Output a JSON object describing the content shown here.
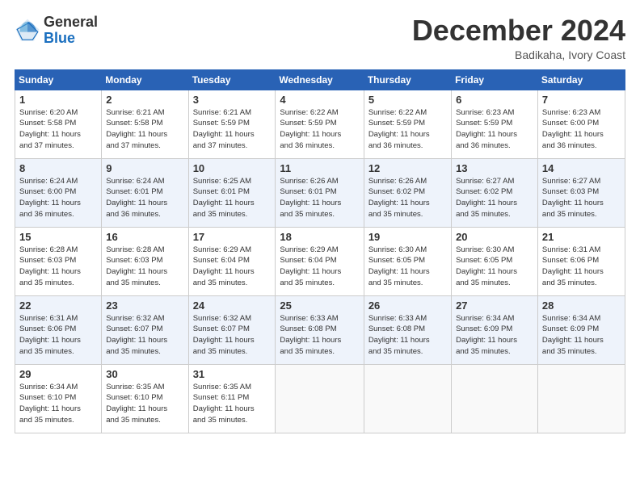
{
  "header": {
    "logo_line1": "General",
    "logo_line2": "Blue",
    "month": "December 2024",
    "location": "Badikaha, Ivory Coast"
  },
  "weekdays": [
    "Sunday",
    "Monday",
    "Tuesday",
    "Wednesday",
    "Thursday",
    "Friday",
    "Saturday"
  ],
  "weeks": [
    [
      {
        "day": "1",
        "info": "Sunrise: 6:20 AM\nSunset: 5:58 PM\nDaylight: 11 hours\nand 37 minutes."
      },
      {
        "day": "2",
        "info": "Sunrise: 6:21 AM\nSunset: 5:58 PM\nDaylight: 11 hours\nand 37 minutes."
      },
      {
        "day": "3",
        "info": "Sunrise: 6:21 AM\nSunset: 5:59 PM\nDaylight: 11 hours\nand 37 minutes."
      },
      {
        "day": "4",
        "info": "Sunrise: 6:22 AM\nSunset: 5:59 PM\nDaylight: 11 hours\nand 36 minutes."
      },
      {
        "day": "5",
        "info": "Sunrise: 6:22 AM\nSunset: 5:59 PM\nDaylight: 11 hours\nand 36 minutes."
      },
      {
        "day": "6",
        "info": "Sunrise: 6:23 AM\nSunset: 5:59 PM\nDaylight: 11 hours\nand 36 minutes."
      },
      {
        "day": "7",
        "info": "Sunrise: 6:23 AM\nSunset: 6:00 PM\nDaylight: 11 hours\nand 36 minutes."
      }
    ],
    [
      {
        "day": "8",
        "info": "Sunrise: 6:24 AM\nSunset: 6:00 PM\nDaylight: 11 hours\nand 36 minutes."
      },
      {
        "day": "9",
        "info": "Sunrise: 6:24 AM\nSunset: 6:01 PM\nDaylight: 11 hours\nand 36 minutes."
      },
      {
        "day": "10",
        "info": "Sunrise: 6:25 AM\nSunset: 6:01 PM\nDaylight: 11 hours\nand 35 minutes."
      },
      {
        "day": "11",
        "info": "Sunrise: 6:26 AM\nSunset: 6:01 PM\nDaylight: 11 hours\nand 35 minutes."
      },
      {
        "day": "12",
        "info": "Sunrise: 6:26 AM\nSunset: 6:02 PM\nDaylight: 11 hours\nand 35 minutes."
      },
      {
        "day": "13",
        "info": "Sunrise: 6:27 AM\nSunset: 6:02 PM\nDaylight: 11 hours\nand 35 minutes."
      },
      {
        "day": "14",
        "info": "Sunrise: 6:27 AM\nSunset: 6:03 PM\nDaylight: 11 hours\nand 35 minutes."
      }
    ],
    [
      {
        "day": "15",
        "info": "Sunrise: 6:28 AM\nSunset: 6:03 PM\nDaylight: 11 hours\nand 35 minutes."
      },
      {
        "day": "16",
        "info": "Sunrise: 6:28 AM\nSunset: 6:03 PM\nDaylight: 11 hours\nand 35 minutes."
      },
      {
        "day": "17",
        "info": "Sunrise: 6:29 AM\nSunset: 6:04 PM\nDaylight: 11 hours\nand 35 minutes."
      },
      {
        "day": "18",
        "info": "Sunrise: 6:29 AM\nSunset: 6:04 PM\nDaylight: 11 hours\nand 35 minutes."
      },
      {
        "day": "19",
        "info": "Sunrise: 6:30 AM\nSunset: 6:05 PM\nDaylight: 11 hours\nand 35 minutes."
      },
      {
        "day": "20",
        "info": "Sunrise: 6:30 AM\nSunset: 6:05 PM\nDaylight: 11 hours\nand 35 minutes."
      },
      {
        "day": "21",
        "info": "Sunrise: 6:31 AM\nSunset: 6:06 PM\nDaylight: 11 hours\nand 35 minutes."
      }
    ],
    [
      {
        "day": "22",
        "info": "Sunrise: 6:31 AM\nSunset: 6:06 PM\nDaylight: 11 hours\nand 35 minutes."
      },
      {
        "day": "23",
        "info": "Sunrise: 6:32 AM\nSunset: 6:07 PM\nDaylight: 11 hours\nand 35 minutes."
      },
      {
        "day": "24",
        "info": "Sunrise: 6:32 AM\nSunset: 6:07 PM\nDaylight: 11 hours\nand 35 minutes."
      },
      {
        "day": "25",
        "info": "Sunrise: 6:33 AM\nSunset: 6:08 PM\nDaylight: 11 hours\nand 35 minutes."
      },
      {
        "day": "26",
        "info": "Sunrise: 6:33 AM\nSunset: 6:08 PM\nDaylight: 11 hours\nand 35 minutes."
      },
      {
        "day": "27",
        "info": "Sunrise: 6:34 AM\nSunset: 6:09 PM\nDaylight: 11 hours\nand 35 minutes."
      },
      {
        "day": "28",
        "info": "Sunrise: 6:34 AM\nSunset: 6:09 PM\nDaylight: 11 hours\nand 35 minutes."
      }
    ],
    [
      {
        "day": "29",
        "info": "Sunrise: 6:34 AM\nSunset: 6:10 PM\nDaylight: 11 hours\nand 35 minutes."
      },
      {
        "day": "30",
        "info": "Sunrise: 6:35 AM\nSunset: 6:10 PM\nDaylight: 11 hours\nand 35 minutes."
      },
      {
        "day": "31",
        "info": "Sunrise: 6:35 AM\nSunset: 6:11 PM\nDaylight: 11 hours\nand 35 minutes."
      },
      null,
      null,
      null,
      null
    ]
  ]
}
